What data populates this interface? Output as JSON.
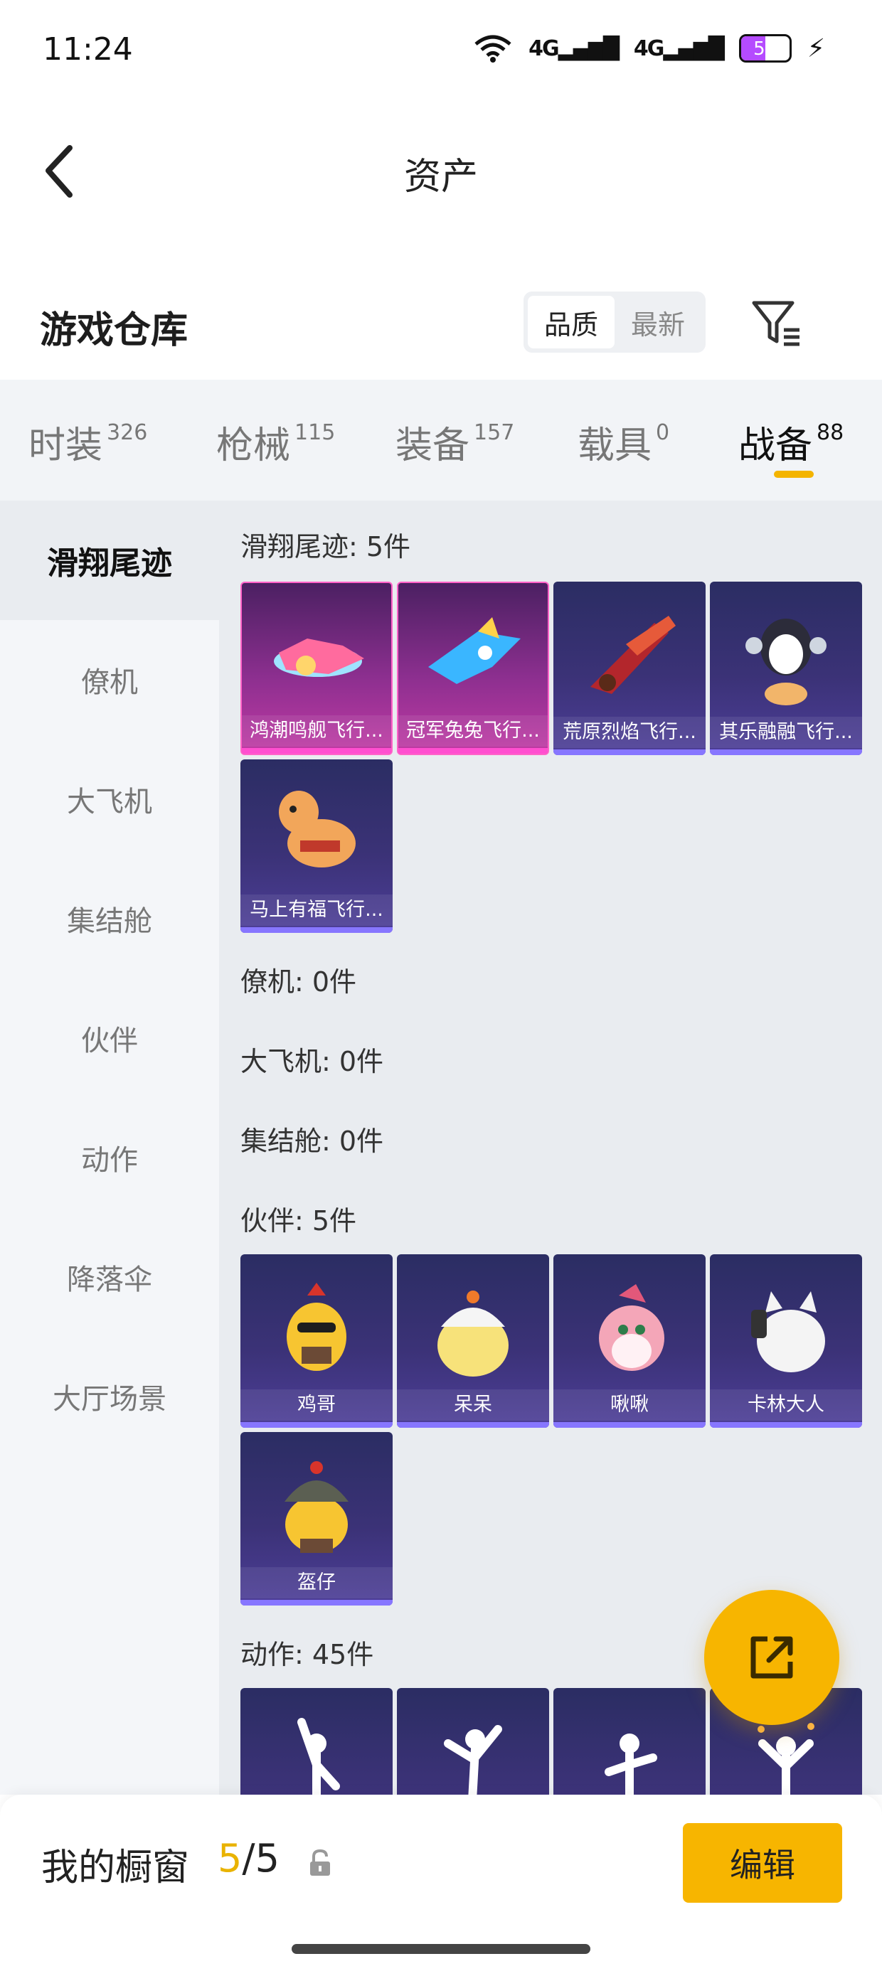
{
  "status_bar": {
    "time": "11:24",
    "signal_1": "4G",
    "signal_2": "4G",
    "battery_level": "51",
    "icons": [
      "wifi-icon",
      "signal-icon",
      "signal-icon",
      "battery-icon",
      "charging-icon"
    ]
  },
  "header": {
    "title": "资产",
    "back_icon": "chevron-left-icon"
  },
  "warehouse": {
    "title": "游戏仓库",
    "sort_options": [
      "品质",
      "最新"
    ],
    "sort_selected": "品质",
    "filter_icon": "filter-icon"
  },
  "tabs": [
    {
      "label": "时装",
      "count": "326"
    },
    {
      "label": "枪械",
      "count": "115"
    },
    {
      "label": "装备",
      "count": "157"
    },
    {
      "label": "载具",
      "count": "0"
    },
    {
      "label": "战备",
      "count": "88"
    }
  ],
  "active_tab": "战备",
  "accent_color": "#f4b400",
  "sidebar": {
    "items": [
      "滑翔尾迹",
      "僚机",
      "大飞机",
      "集结舱",
      "伙伴",
      "动作",
      "降落伞",
      "大厅场景"
    ],
    "active": "滑翔尾迹"
  },
  "sections": {
    "glide": {
      "title": "滑翔尾迹: 5件",
      "items": [
        "鸿潮鸣舰飞行...",
        "冠军兔兔飞行...",
        "荒原烈焰飞行...",
        "其乐融融飞行...",
        "马上有福飞行..."
      ]
    },
    "wingman": {
      "title": "僚机: 0件"
    },
    "bigplane": {
      "title": "大飞机: 0件"
    },
    "pod": {
      "title": "集结舱: 0件"
    },
    "partner": {
      "title": "伙伴: 5件",
      "items": [
        "鸡哥",
        "呆呆",
        "啾啾",
        "卡林大人",
        "盔仔"
      ]
    },
    "emote": {
      "title": "动作: 45件"
    }
  },
  "fab": {
    "icon": "share-external-icon"
  },
  "bottom": {
    "label": "我的橱窗",
    "current": "5",
    "separator": "/",
    "total": "5",
    "lock_icon": "lock-icon",
    "edit_label": "编辑"
  }
}
